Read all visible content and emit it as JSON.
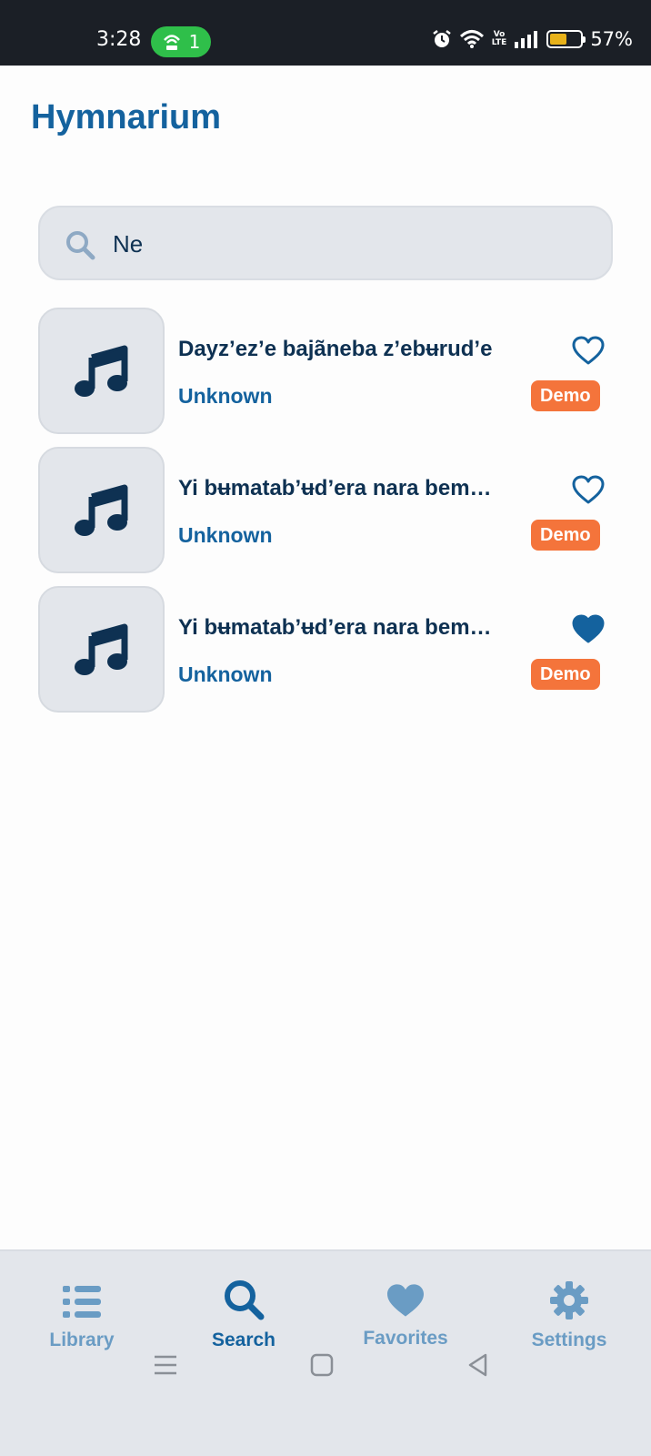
{
  "status_bar": {
    "time": "3:28",
    "hotspot_count": "1",
    "battery": "57%",
    "volte": "Vo\nLTE",
    "battery_level": 0.57
  },
  "app": {
    "title": "Hymnarium"
  },
  "search": {
    "value": "Ne",
    "placeholder": ""
  },
  "results": [
    {
      "title": "Dayz’ez’e bajãneba z’ebʉrud’e",
      "artist": "Unknown",
      "badge": "Demo",
      "favorite": false
    },
    {
      "title": "Yi bʉmatab’ʉd’era nara bem…",
      "artist": "Unknown",
      "badge": "Demo",
      "favorite": false
    },
    {
      "title": "Yi bʉmatab’ʉd’era nara bem…",
      "artist": "Unknown",
      "badge": "Demo",
      "favorite": true
    }
  ],
  "nav": {
    "library": "Library",
    "search": "Search",
    "favorites": "Favorites",
    "settings": "Settings",
    "active": "search"
  },
  "colors": {
    "primary": "#14629e",
    "dark_text": "#0e3152",
    "badge": "#f4743b",
    "nav_inactive": "#6a9cc4",
    "surface": "#e3e6eb"
  }
}
